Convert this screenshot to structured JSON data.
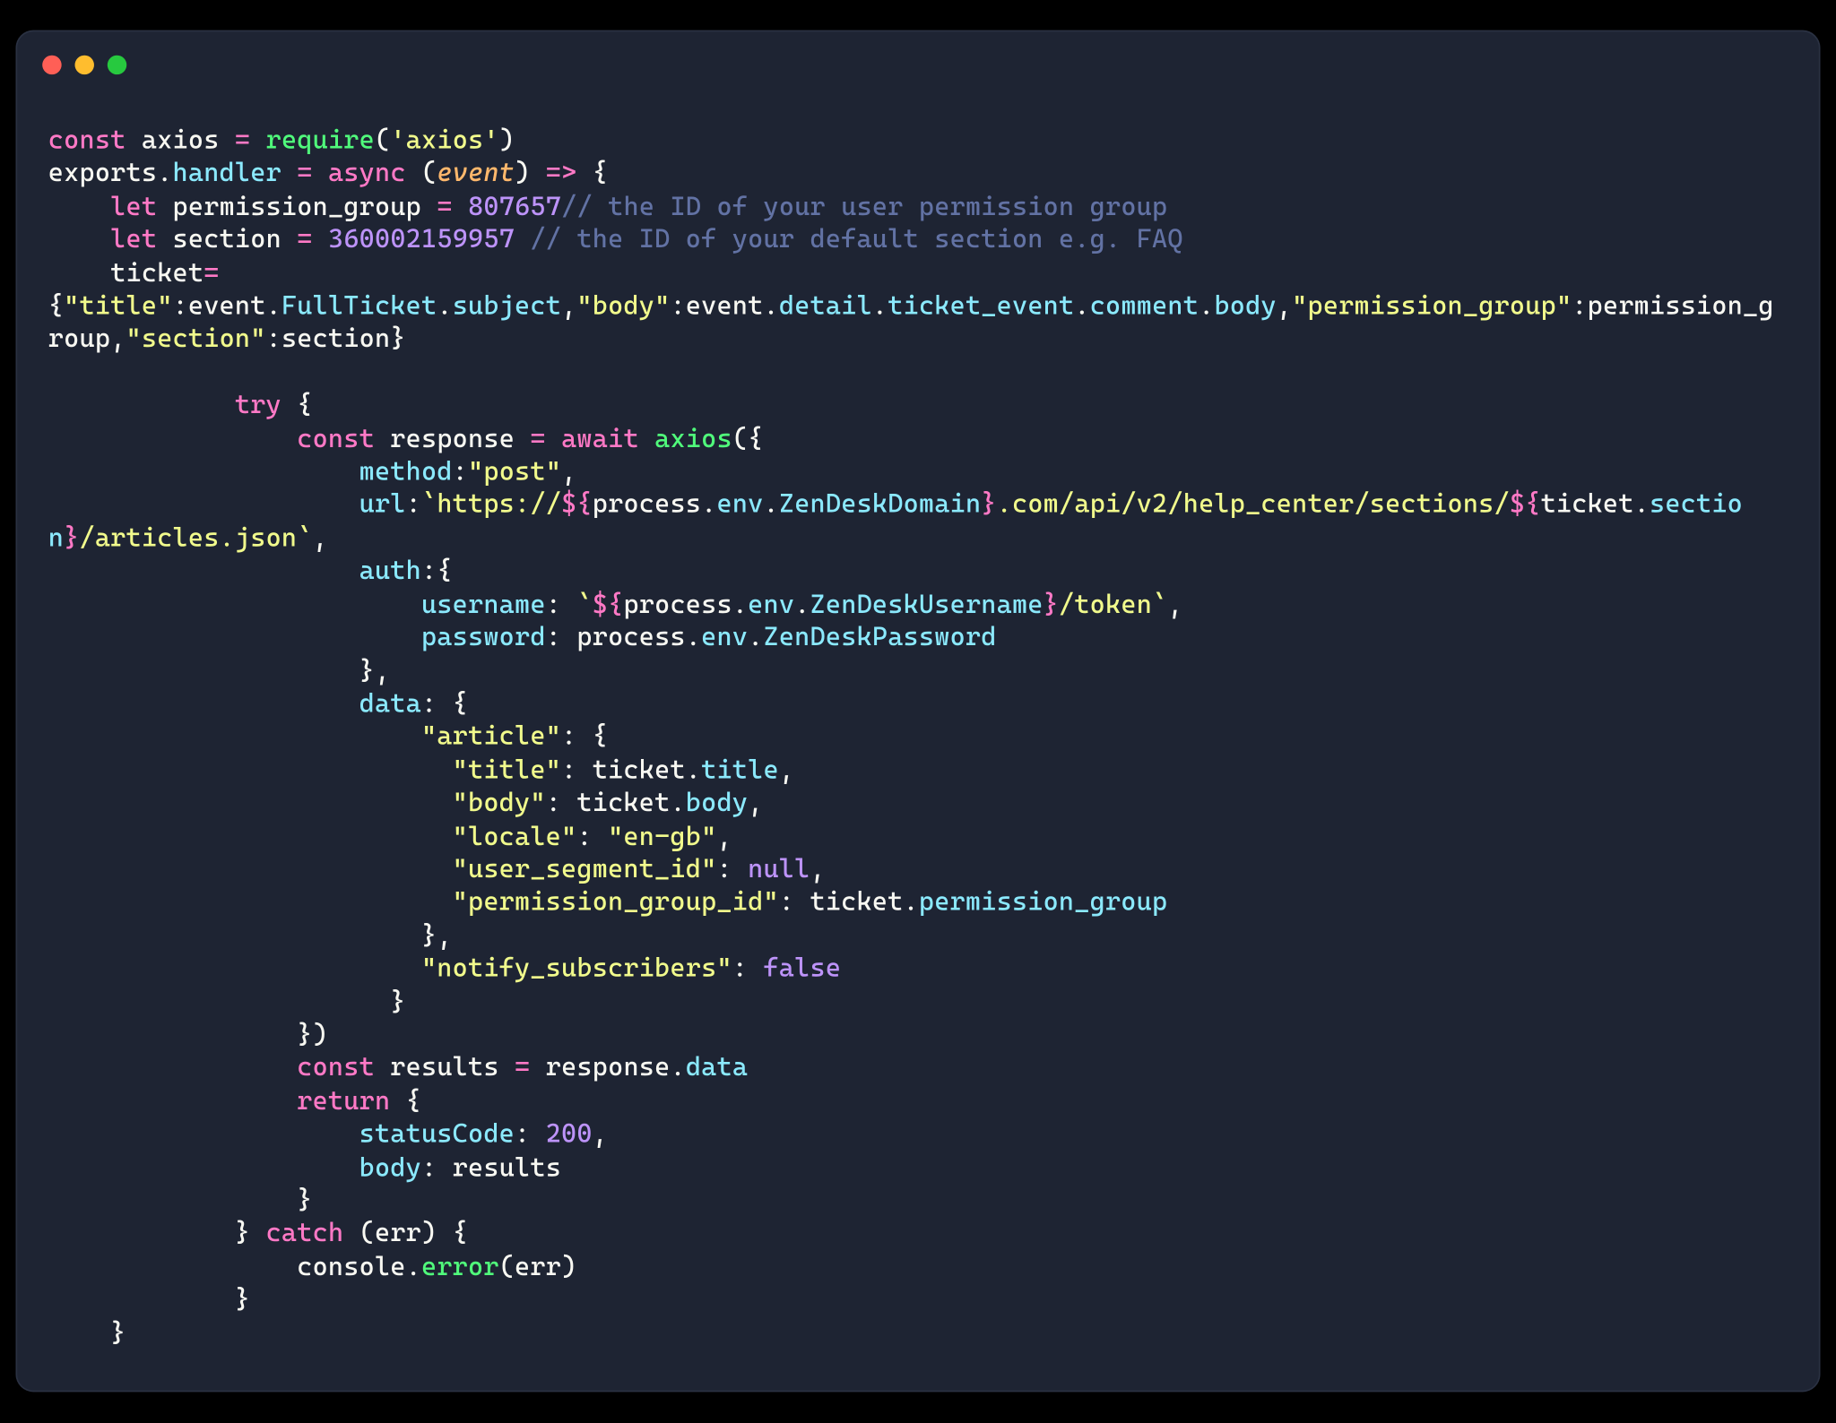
{
  "window": {
    "traffic_lights": [
      "close",
      "minimize",
      "zoom"
    ]
  },
  "code": {
    "lines": [
      [
        {
          "cls": "kw",
          "txt": "const"
        },
        {
          "cls": "pn",
          "txt": " "
        },
        {
          "cls": "id",
          "txt": "axios"
        },
        {
          "cls": "pn",
          "txt": " "
        },
        {
          "cls": "kw",
          "txt": "="
        },
        {
          "cls": "pn",
          "txt": " "
        },
        {
          "cls": "fn",
          "txt": "require"
        },
        {
          "cls": "pn",
          "txt": "("
        },
        {
          "cls": "str",
          "txt": "'axios'"
        },
        {
          "cls": "pn",
          "txt": ")"
        }
      ],
      [
        {
          "cls": "id",
          "txt": "exports"
        },
        {
          "cls": "pn",
          "txt": "."
        },
        {
          "cls": "prop",
          "txt": "handler"
        },
        {
          "cls": "pn",
          "txt": " "
        },
        {
          "cls": "kw",
          "txt": "="
        },
        {
          "cls": "pn",
          "txt": " "
        },
        {
          "cls": "kw",
          "txt": "async"
        },
        {
          "cls": "pn",
          "txt": " ("
        },
        {
          "cls": "par",
          "txt": "event"
        },
        {
          "cls": "pn",
          "txt": ") "
        },
        {
          "cls": "kw",
          "txt": "=>"
        },
        {
          "cls": "pn",
          "txt": " {"
        }
      ],
      [
        {
          "cls": "pn",
          "txt": "    "
        },
        {
          "cls": "kw",
          "txt": "let"
        },
        {
          "cls": "pn",
          "txt": " "
        },
        {
          "cls": "id",
          "txt": "permission_group"
        },
        {
          "cls": "pn",
          "txt": " "
        },
        {
          "cls": "kw",
          "txt": "="
        },
        {
          "cls": "pn",
          "txt": " "
        },
        {
          "cls": "num",
          "txt": "807657"
        },
        {
          "cls": "cmt",
          "txt": "// the ID of your user permission group"
        }
      ],
      [
        {
          "cls": "pn",
          "txt": "    "
        },
        {
          "cls": "kw",
          "txt": "let"
        },
        {
          "cls": "pn",
          "txt": " "
        },
        {
          "cls": "id",
          "txt": "section"
        },
        {
          "cls": "pn",
          "txt": " "
        },
        {
          "cls": "kw",
          "txt": "="
        },
        {
          "cls": "pn",
          "txt": " "
        },
        {
          "cls": "num",
          "txt": "360002159957"
        },
        {
          "cls": "pn",
          "txt": " "
        },
        {
          "cls": "cmt",
          "txt": "// the ID of your default section e.g. FAQ"
        }
      ],
      [
        {
          "cls": "pn",
          "txt": "    "
        },
        {
          "cls": "id",
          "txt": "ticket"
        },
        {
          "cls": "kw",
          "txt": "="
        }
      ],
      [
        {
          "cls": "pn",
          "txt": "{"
        },
        {
          "cls": "str",
          "txt": "\"title\""
        },
        {
          "cls": "pn",
          "txt": ":"
        },
        {
          "cls": "id",
          "txt": "event"
        },
        {
          "cls": "pn",
          "txt": "."
        },
        {
          "cls": "prop",
          "txt": "FullTicket"
        },
        {
          "cls": "pn",
          "txt": "."
        },
        {
          "cls": "prop",
          "txt": "subject"
        },
        {
          "cls": "pn",
          "txt": ","
        },
        {
          "cls": "str",
          "txt": "\"body\""
        },
        {
          "cls": "pn",
          "txt": ":"
        },
        {
          "cls": "id",
          "txt": "event"
        },
        {
          "cls": "pn",
          "txt": "."
        },
        {
          "cls": "prop",
          "txt": "detail"
        },
        {
          "cls": "pn",
          "txt": "."
        },
        {
          "cls": "prop",
          "txt": "ticket_event"
        },
        {
          "cls": "pn",
          "txt": "."
        },
        {
          "cls": "prop",
          "txt": "comment"
        },
        {
          "cls": "pn",
          "txt": "."
        },
        {
          "cls": "prop",
          "txt": "body"
        },
        {
          "cls": "pn",
          "txt": ","
        },
        {
          "cls": "str",
          "txt": "\"permission_group\""
        },
        {
          "cls": "pn",
          "txt": ":"
        },
        {
          "cls": "id",
          "txt": "permission_group"
        },
        {
          "cls": "pn",
          "txt": ","
        },
        {
          "cls": "str",
          "txt": "\"section\""
        },
        {
          "cls": "pn",
          "txt": ":"
        },
        {
          "cls": "id",
          "txt": "section"
        },
        {
          "cls": "pn",
          "txt": "}"
        }
      ],
      [],
      [
        {
          "cls": "pn",
          "txt": "            "
        },
        {
          "cls": "kw",
          "txt": "try"
        },
        {
          "cls": "pn",
          "txt": " {"
        }
      ],
      [
        {
          "cls": "pn",
          "txt": "                "
        },
        {
          "cls": "kw",
          "txt": "const"
        },
        {
          "cls": "pn",
          "txt": " "
        },
        {
          "cls": "id",
          "txt": "response"
        },
        {
          "cls": "pn",
          "txt": " "
        },
        {
          "cls": "kw",
          "txt": "="
        },
        {
          "cls": "pn",
          "txt": " "
        },
        {
          "cls": "kw",
          "txt": "await"
        },
        {
          "cls": "pn",
          "txt": " "
        },
        {
          "cls": "fn",
          "txt": "axios"
        },
        {
          "cls": "pn",
          "txt": "({"
        }
      ],
      [
        {
          "cls": "pn",
          "txt": "                    "
        },
        {
          "cls": "prop",
          "txt": "method"
        },
        {
          "cls": "pn",
          "txt": ":"
        },
        {
          "cls": "str",
          "txt": "\"post\""
        },
        {
          "cls": "pn",
          "txt": ","
        }
      ],
      [
        {
          "cls": "pn",
          "txt": "                    "
        },
        {
          "cls": "prop",
          "txt": "url"
        },
        {
          "cls": "pn",
          "txt": ":"
        },
        {
          "cls": "tmpl",
          "txt": "`https://"
        },
        {
          "cls": "kw",
          "txt": "${"
        },
        {
          "cls": "id",
          "txt": "process"
        },
        {
          "cls": "pn",
          "txt": "."
        },
        {
          "cls": "prop",
          "txt": "env"
        },
        {
          "cls": "pn",
          "txt": "."
        },
        {
          "cls": "prop",
          "txt": "ZenDeskDomain"
        },
        {
          "cls": "kw",
          "txt": "}"
        },
        {
          "cls": "tmpl",
          "txt": ".com/api/v2/help_center/sections/"
        },
        {
          "cls": "kw",
          "txt": "${"
        },
        {
          "cls": "id",
          "txt": "ticket"
        },
        {
          "cls": "pn",
          "txt": "."
        },
        {
          "cls": "prop",
          "txt": "section"
        },
        {
          "cls": "kw",
          "txt": "}"
        },
        {
          "cls": "tmpl",
          "txt": "/articles.json`"
        },
        {
          "cls": "pn",
          "txt": ","
        }
      ],
      [
        {
          "cls": "pn",
          "txt": "                    "
        },
        {
          "cls": "prop",
          "txt": "auth"
        },
        {
          "cls": "pn",
          "txt": ":{"
        }
      ],
      [
        {
          "cls": "pn",
          "txt": "                        "
        },
        {
          "cls": "prop",
          "txt": "username"
        },
        {
          "cls": "pn",
          "txt": ": "
        },
        {
          "cls": "tmpl",
          "txt": "`"
        },
        {
          "cls": "kw",
          "txt": "${"
        },
        {
          "cls": "id",
          "txt": "process"
        },
        {
          "cls": "pn",
          "txt": "."
        },
        {
          "cls": "prop",
          "txt": "env"
        },
        {
          "cls": "pn",
          "txt": "."
        },
        {
          "cls": "prop",
          "txt": "ZenDeskUsername"
        },
        {
          "cls": "kw",
          "txt": "}"
        },
        {
          "cls": "tmpl",
          "txt": "/token`"
        },
        {
          "cls": "pn",
          "txt": ","
        }
      ],
      [
        {
          "cls": "pn",
          "txt": "                        "
        },
        {
          "cls": "prop",
          "txt": "password"
        },
        {
          "cls": "pn",
          "txt": ": "
        },
        {
          "cls": "id",
          "txt": "process"
        },
        {
          "cls": "pn",
          "txt": "."
        },
        {
          "cls": "prop",
          "txt": "env"
        },
        {
          "cls": "pn",
          "txt": "."
        },
        {
          "cls": "prop",
          "txt": "ZenDeskPassword"
        }
      ],
      [
        {
          "cls": "pn",
          "txt": "                    },"
        }
      ],
      [
        {
          "cls": "pn",
          "txt": "                    "
        },
        {
          "cls": "prop",
          "txt": "data"
        },
        {
          "cls": "pn",
          "txt": ": {"
        }
      ],
      [
        {
          "cls": "pn",
          "txt": "                        "
        },
        {
          "cls": "str",
          "txt": "\"article\""
        },
        {
          "cls": "pn",
          "txt": ": {"
        }
      ],
      [
        {
          "cls": "pn",
          "txt": "                          "
        },
        {
          "cls": "str",
          "txt": "\"title\""
        },
        {
          "cls": "pn",
          "txt": ": "
        },
        {
          "cls": "id",
          "txt": "ticket"
        },
        {
          "cls": "pn",
          "txt": "."
        },
        {
          "cls": "prop",
          "txt": "title"
        },
        {
          "cls": "pn",
          "txt": ","
        }
      ],
      [
        {
          "cls": "pn",
          "txt": "                          "
        },
        {
          "cls": "str",
          "txt": "\"body\""
        },
        {
          "cls": "pn",
          "txt": ": "
        },
        {
          "cls": "id",
          "txt": "ticket"
        },
        {
          "cls": "pn",
          "txt": "."
        },
        {
          "cls": "prop",
          "txt": "body"
        },
        {
          "cls": "pn",
          "txt": ","
        }
      ],
      [
        {
          "cls": "pn",
          "txt": "                          "
        },
        {
          "cls": "str",
          "txt": "\"locale\""
        },
        {
          "cls": "pn",
          "txt": ": "
        },
        {
          "cls": "str",
          "txt": "\"en-gb\""
        },
        {
          "cls": "pn",
          "txt": ","
        }
      ],
      [
        {
          "cls": "pn",
          "txt": "                          "
        },
        {
          "cls": "str",
          "txt": "\"user_segment_id\""
        },
        {
          "cls": "pn",
          "txt": ": "
        },
        {
          "cls": "num",
          "txt": "null"
        },
        {
          "cls": "pn",
          "txt": ","
        }
      ],
      [
        {
          "cls": "pn",
          "txt": "                          "
        },
        {
          "cls": "str",
          "txt": "\"permission_group_id\""
        },
        {
          "cls": "pn",
          "txt": ": "
        },
        {
          "cls": "id",
          "txt": "ticket"
        },
        {
          "cls": "pn",
          "txt": "."
        },
        {
          "cls": "prop",
          "txt": "permission_group"
        }
      ],
      [
        {
          "cls": "pn",
          "txt": "                        },"
        }
      ],
      [
        {
          "cls": "pn",
          "txt": "                        "
        },
        {
          "cls": "str",
          "txt": "\"notify_subscribers\""
        },
        {
          "cls": "pn",
          "txt": ": "
        },
        {
          "cls": "num",
          "txt": "false"
        }
      ],
      [
        {
          "cls": "pn",
          "txt": "                      }"
        }
      ],
      [
        {
          "cls": "pn",
          "txt": "                })"
        }
      ],
      [
        {
          "cls": "pn",
          "txt": "                "
        },
        {
          "cls": "kw",
          "txt": "const"
        },
        {
          "cls": "pn",
          "txt": " "
        },
        {
          "cls": "id",
          "txt": "results"
        },
        {
          "cls": "pn",
          "txt": " "
        },
        {
          "cls": "kw",
          "txt": "="
        },
        {
          "cls": "pn",
          "txt": " "
        },
        {
          "cls": "id",
          "txt": "response"
        },
        {
          "cls": "pn",
          "txt": "."
        },
        {
          "cls": "prop",
          "txt": "data"
        }
      ],
      [
        {
          "cls": "pn",
          "txt": "                "
        },
        {
          "cls": "kw",
          "txt": "return"
        },
        {
          "cls": "pn",
          "txt": " {"
        }
      ],
      [
        {
          "cls": "pn",
          "txt": "                    "
        },
        {
          "cls": "prop",
          "txt": "statusCode"
        },
        {
          "cls": "pn",
          "txt": ": "
        },
        {
          "cls": "num",
          "txt": "200"
        },
        {
          "cls": "pn",
          "txt": ","
        }
      ],
      [
        {
          "cls": "pn",
          "txt": "                    "
        },
        {
          "cls": "prop",
          "txt": "body"
        },
        {
          "cls": "pn",
          "txt": ": "
        },
        {
          "cls": "id",
          "txt": "results"
        }
      ],
      [
        {
          "cls": "pn",
          "txt": "                }"
        }
      ],
      [
        {
          "cls": "pn",
          "txt": "            } "
        },
        {
          "cls": "kw",
          "txt": "catch"
        },
        {
          "cls": "pn",
          "txt": " ("
        },
        {
          "cls": "id",
          "txt": "err"
        },
        {
          "cls": "pn",
          "txt": ") {"
        }
      ],
      [
        {
          "cls": "pn",
          "txt": "                "
        },
        {
          "cls": "id",
          "txt": "console"
        },
        {
          "cls": "pn",
          "txt": "."
        },
        {
          "cls": "fn",
          "txt": "error"
        },
        {
          "cls": "pn",
          "txt": "("
        },
        {
          "cls": "id",
          "txt": "err"
        },
        {
          "cls": "pn",
          "txt": ")"
        }
      ],
      [
        {
          "cls": "pn",
          "txt": "            }"
        }
      ],
      [
        {
          "cls": "pn",
          "txt": "    }"
        }
      ]
    ]
  }
}
